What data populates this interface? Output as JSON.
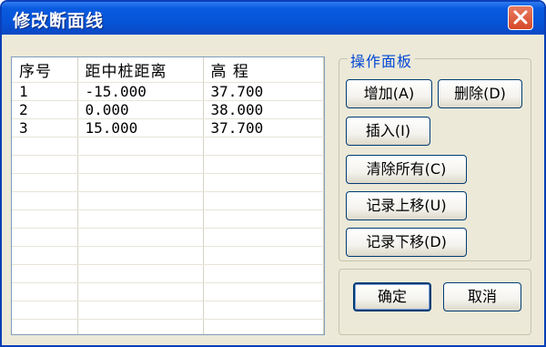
{
  "window": {
    "title": "修改断面线"
  },
  "table": {
    "headers": [
      "序号",
      "距中桩距离",
      "高  程"
    ],
    "rows": [
      [
        "1",
        "-15.000",
        "37.700"
      ],
      [
        "2",
        "0.000",
        "38.000"
      ],
      [
        "3",
        "15.000",
        "37.700"
      ]
    ]
  },
  "panel": {
    "title": "操作面板",
    "add_label": "增加(A)",
    "delete_label": "删除(D)",
    "insert_label": "插入(I)",
    "clear_all_label": "清除所有(C)",
    "move_up_label": "记录上移(U)",
    "move_down_label": "记录下移(D)"
  },
  "footer": {
    "ok_label": "确定",
    "cancel_label": "取消"
  }
}
